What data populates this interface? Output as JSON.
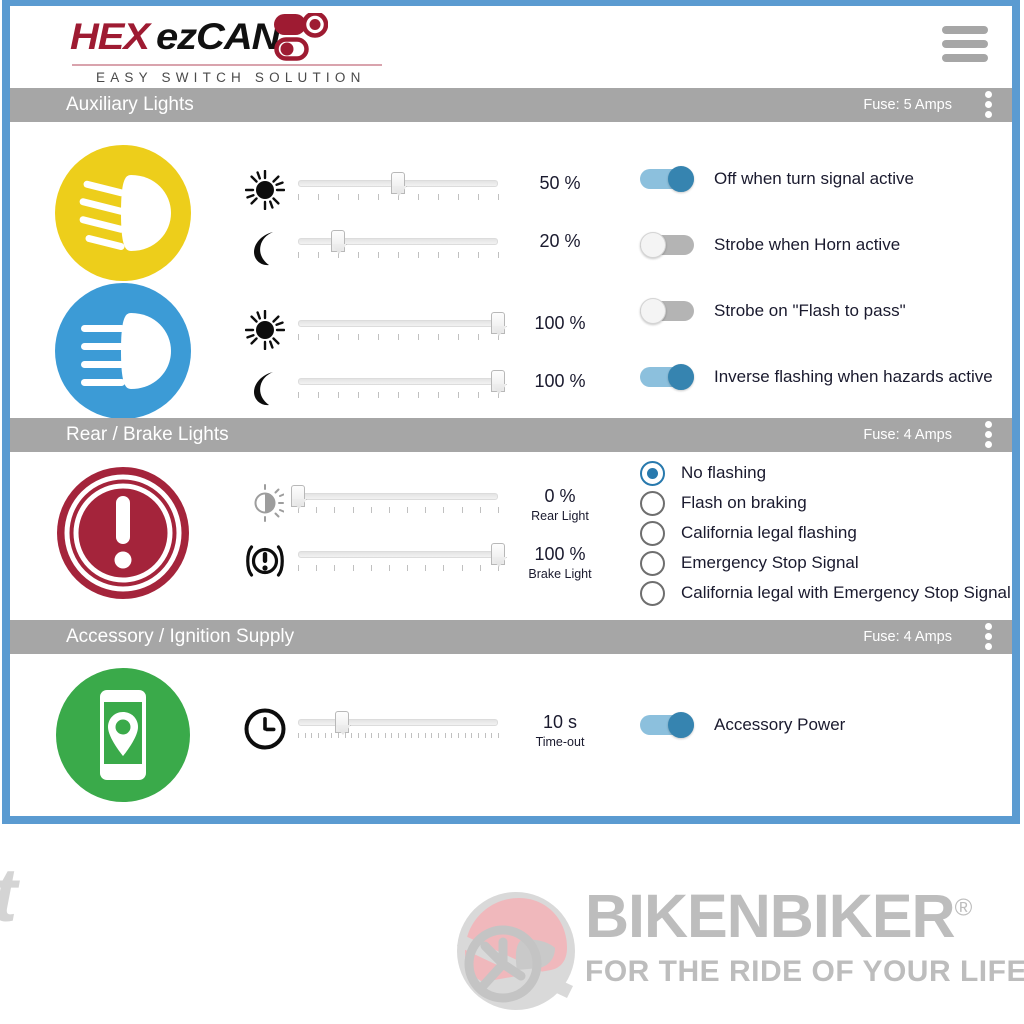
{
  "brand": {
    "logo_hex": "HEX",
    "logo_ezcan": "ezCAN",
    "tagline": "EASY SWITCH SOLUTION",
    "logo_color": "#9e1b32",
    "accent_color": "#5b9bd1"
  },
  "header": {
    "menu_icon": "hamburger-menu-icon"
  },
  "sections": [
    {
      "id": "auxiliary-lights",
      "title": "Auxiliary Lights",
      "fuse": "Fuse: 5 Amps",
      "icons": [
        {
          "name": "high-beam-headlight-icon",
          "color": "#edce1b"
        },
        {
          "name": "low-beam-headlight-icon",
          "color": "#3c9bd6"
        }
      ],
      "sliders": [
        {
          "icon": "sun-icon",
          "value": "50 %",
          "percent": 50,
          "sub": ""
        },
        {
          "icon": "moon-icon",
          "value": "20 %",
          "percent": 20,
          "sub": ""
        },
        {
          "icon": "sun-icon",
          "value": "100 %",
          "percent": 100,
          "sub": ""
        },
        {
          "icon": "moon-icon",
          "value": "100 %",
          "percent": 100,
          "sub": ""
        }
      ],
      "toggles": [
        {
          "label": "Off when turn signal active",
          "on": true
        },
        {
          "label": "Strobe when Horn active",
          "on": false
        },
        {
          "label": "Strobe on \"Flash to pass\"",
          "on": false
        },
        {
          "label": "Inverse flashing when hazards active",
          "on": true
        }
      ]
    },
    {
      "id": "rear-brake-lights",
      "title": "Rear / Brake Lights",
      "fuse": "Fuse: 4 Amps",
      "icons": [
        {
          "name": "brake-warning-circle-icon",
          "color": "#a4243b"
        }
      ],
      "sliders": [
        {
          "icon": "brightness-icon",
          "value": "0 %",
          "percent": 0,
          "sub": "Rear Light"
        },
        {
          "icon": "brake-warning-icon",
          "value": "100 %",
          "percent": 100,
          "sub": "Brake Light"
        }
      ],
      "radios": [
        {
          "label": "No flashing",
          "checked": true
        },
        {
          "label": "Flash on braking",
          "checked": false
        },
        {
          "label": "California legal flashing",
          "checked": false
        },
        {
          "label": "Emergency Stop Signal",
          "checked": false
        },
        {
          "label": "California legal with Emergency Stop Signal",
          "checked": false
        }
      ]
    },
    {
      "id": "accessory-ignition-supply",
      "title": "Accessory / Ignition Supply",
      "fuse": "Fuse: 4 Amps",
      "icons": [
        {
          "name": "phone-location-icon",
          "color": "#3aaa4a"
        }
      ],
      "sliders": [
        {
          "icon": "clock-icon",
          "value": "10 s",
          "percent": 22,
          "sub": "Time-out"
        }
      ],
      "toggles": [
        {
          "label": "Accessory Power",
          "on": true
        }
      ]
    }
  ],
  "watermark": {
    "title": "BIKENBIKER",
    "registered": "®",
    "subtitle": "FOR THE RIDE OF YOUR LIFE",
    "color": "#bdbdbd",
    "helmet_accent": "#f0b8bc"
  }
}
